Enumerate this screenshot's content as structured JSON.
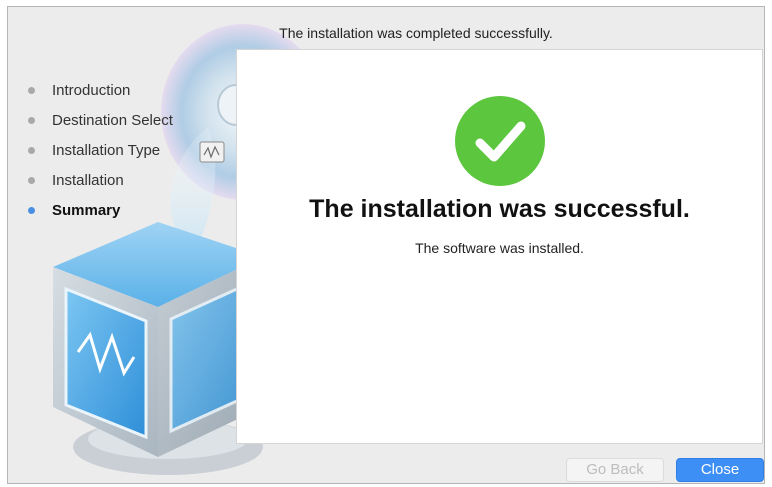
{
  "window": {
    "header_title": "The installation was completed successfully."
  },
  "sidebar": {
    "steps": [
      {
        "label": "Introduction",
        "active": false
      },
      {
        "label": "Destination Select",
        "active": false
      },
      {
        "label": "Installation Type",
        "active": false
      },
      {
        "label": "Installation",
        "active": false
      },
      {
        "label": "Summary",
        "active": true
      }
    ]
  },
  "main": {
    "status_icon": "checkmark-circle-icon",
    "success_title": "The installation was successful.",
    "success_subtitle": "The software was installed."
  },
  "buttons": {
    "go_back_label": "Go Back",
    "close_label": "Close"
  },
  "colors": {
    "accent": "#3e8ff5",
    "success": "#5cc63f",
    "active_step_dot": "#4a90e2"
  }
}
